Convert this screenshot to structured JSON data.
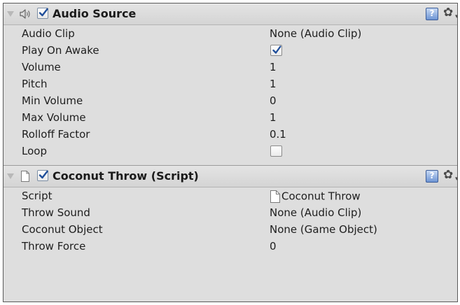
{
  "components": [
    {
      "title": "Audio Source",
      "icon": "speaker-icon",
      "enabled": true,
      "properties": [
        {
          "label": "Audio Clip",
          "value": "None (Audio Clip)"
        },
        {
          "label": "Play On Awake",
          "checked": true
        },
        {
          "label": "Volume",
          "value": "1"
        },
        {
          "label": "Pitch",
          "value": "1"
        },
        {
          "label": "Min Volume",
          "value": "0"
        },
        {
          "label": "Max Volume",
          "value": "1"
        },
        {
          "label": "Rolloff Factor",
          "value": "0.1"
        },
        {
          "label": "Loop",
          "checked": false
        }
      ]
    },
    {
      "title": "Coconut Throw (Script)",
      "icon": "script-file-icon",
      "enabled": true,
      "properties": [
        {
          "label": "Script",
          "value": "Coconut Throw"
        },
        {
          "label": "Throw Sound",
          "value": "None (Audio Clip)"
        },
        {
          "label": "Coconut Object",
          "value": "None (Game Object)"
        },
        {
          "label": "Throw Force",
          "value": "0"
        }
      ]
    }
  ],
  "help_icon_glyph": "?",
  "gear_icon_glyph": "✿",
  "menu_caret_glyph": "▾",
  "colors": {
    "checkmark": "#1f4e9a",
    "help_icon": "#6e95d4",
    "panel_background": "#dedede"
  }
}
